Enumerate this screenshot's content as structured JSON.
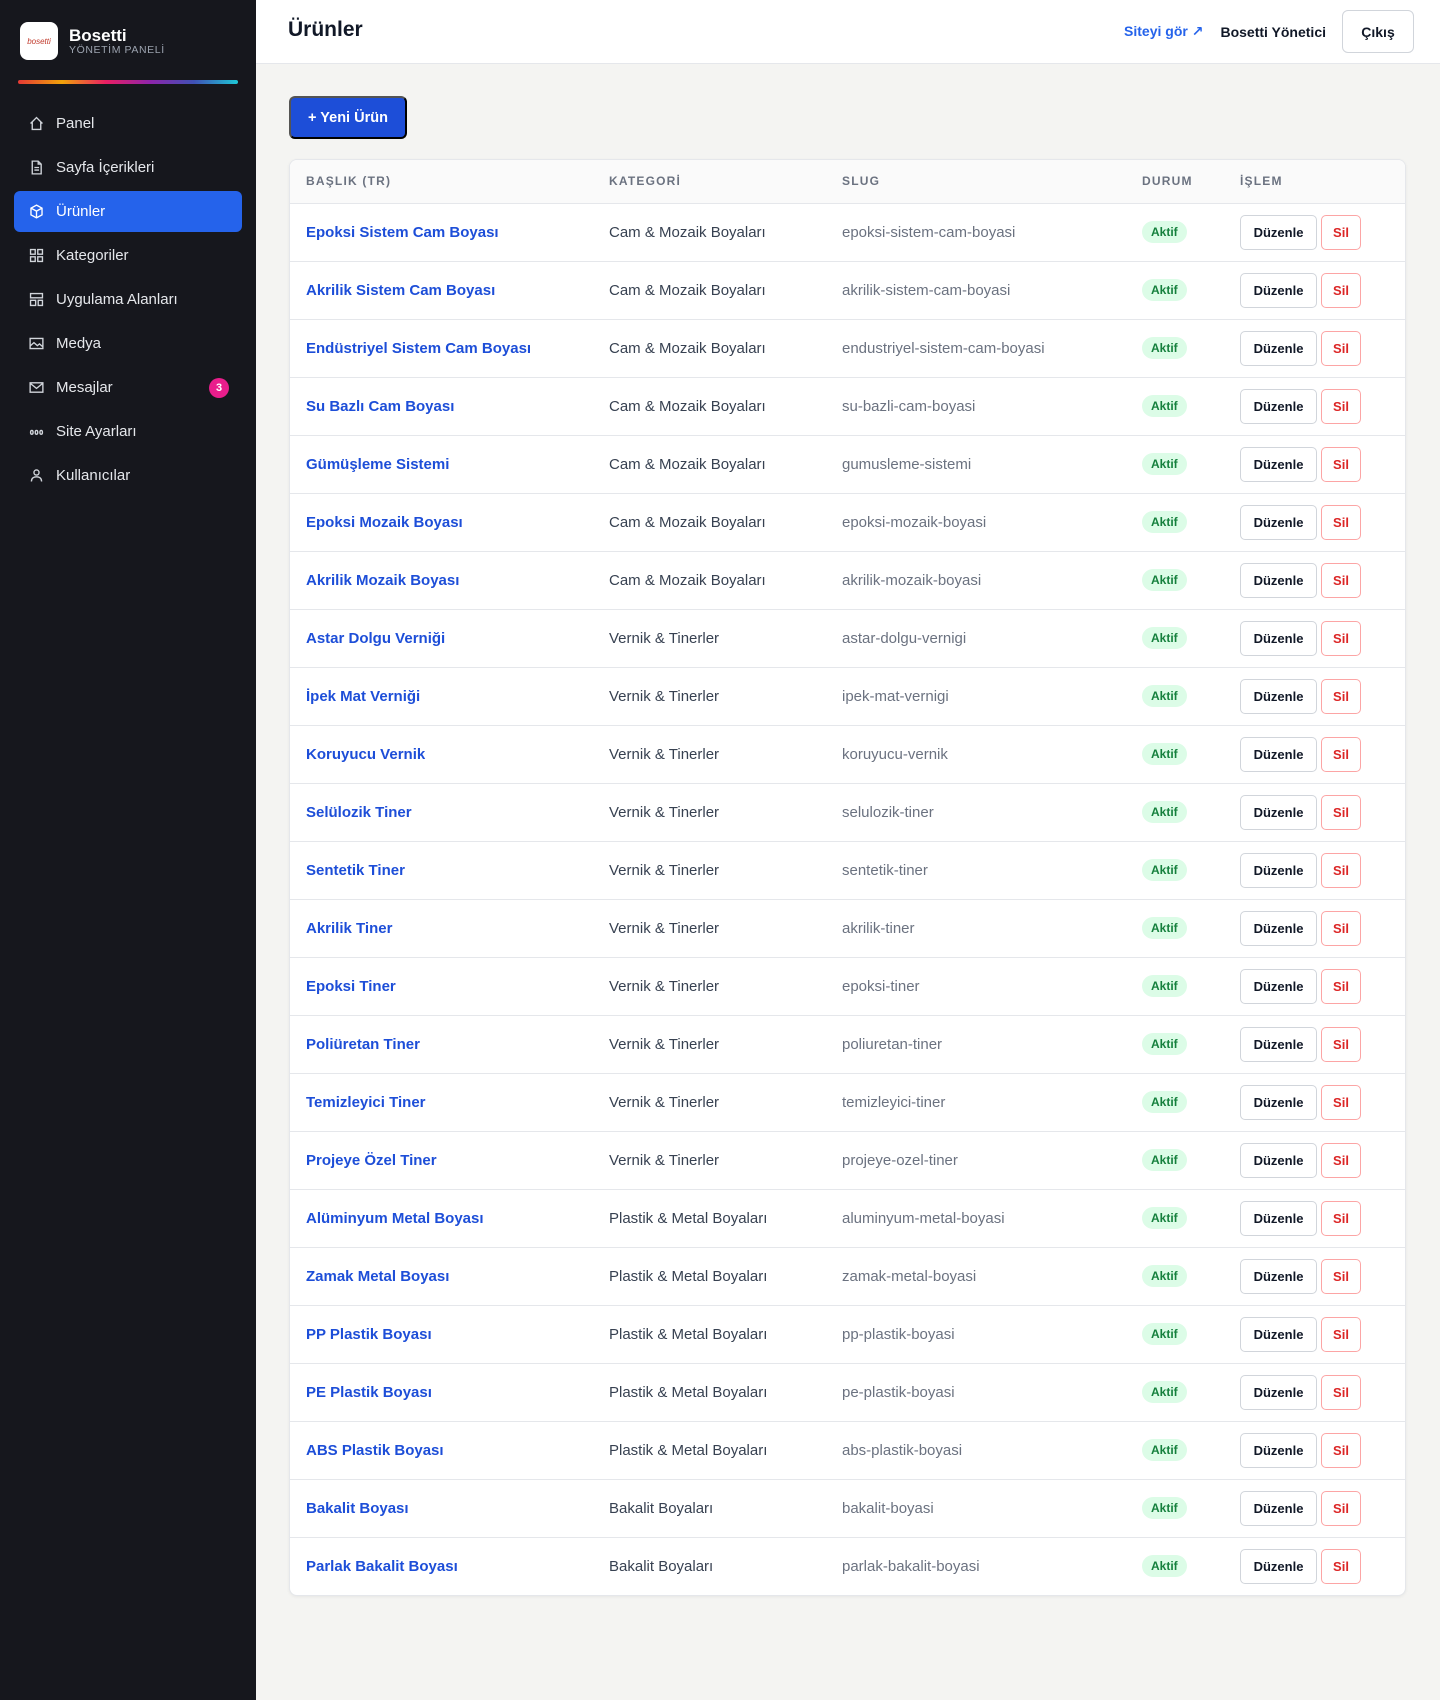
{
  "brand": {
    "logo_text": "bosetti",
    "name": "Bosetti",
    "subtitle": "YÖNETİM PANELİ"
  },
  "nav": [
    {
      "label": "Panel",
      "icon": "home-icon",
      "active": false
    },
    {
      "label": "Sayfa İçerikleri",
      "icon": "document-icon",
      "active": false
    },
    {
      "label": "Ürünler",
      "icon": "box-icon",
      "active": true
    },
    {
      "label": "Kategoriler",
      "icon": "grid-icon",
      "active": false
    },
    {
      "label": "Uygulama Alanları",
      "icon": "layout-icon",
      "active": false
    },
    {
      "label": "Medya",
      "icon": "image-icon",
      "active": false
    },
    {
      "label": "Mesajlar",
      "icon": "mail-icon",
      "active": false,
      "badge": "3"
    },
    {
      "label": "Site Ayarları",
      "icon": "settings-icon",
      "active": false
    },
    {
      "label": "Kullanıcılar",
      "icon": "user-icon",
      "active": false
    }
  ],
  "header": {
    "title": "Ürünler",
    "site_link": "Siteyi gör ↗",
    "admin_name": "Bosetti Yönetici",
    "logout": "Çıkış"
  },
  "new_button": "+ Yeni Ürün",
  "table": {
    "columns": [
      "BAŞLIK (TR)",
      "KATEGORİ",
      "SLUG",
      "DURUM",
      "İŞLEM"
    ],
    "edit_label": "Düzenle",
    "delete_label": "Sil",
    "rows": [
      {
        "title": "Epoksi Sistem Cam Boyası",
        "category": "Cam & Mozaik Boyaları",
        "slug": "epoksi-sistem-cam-boyasi",
        "status": "Aktif"
      },
      {
        "title": "Akrilik Sistem Cam Boyası",
        "category": "Cam & Mozaik Boyaları",
        "slug": "akrilik-sistem-cam-boyasi",
        "status": "Aktif"
      },
      {
        "title": "Endüstriyel Sistem Cam Boyası",
        "category": "Cam & Mozaik Boyaları",
        "slug": "endustriyel-sistem-cam-boyasi",
        "status": "Aktif"
      },
      {
        "title": "Su Bazlı Cam Boyası",
        "category": "Cam & Mozaik Boyaları",
        "slug": "su-bazli-cam-boyasi",
        "status": "Aktif"
      },
      {
        "title": "Gümüşleme Sistemi",
        "category": "Cam & Mozaik Boyaları",
        "slug": "gumusleme-sistemi",
        "status": "Aktif"
      },
      {
        "title": "Epoksi Mozaik Boyası",
        "category": "Cam & Mozaik Boyaları",
        "slug": "epoksi-mozaik-boyasi",
        "status": "Aktif"
      },
      {
        "title": "Akrilik Mozaik Boyası",
        "category": "Cam & Mozaik Boyaları",
        "slug": "akrilik-mozaik-boyasi",
        "status": "Aktif"
      },
      {
        "title": "Astar Dolgu Verniği",
        "category": "Vernik & Tinerler",
        "slug": "astar-dolgu-vernigi",
        "status": "Aktif"
      },
      {
        "title": "İpek Mat Verniği",
        "category": "Vernik & Tinerler",
        "slug": "ipek-mat-vernigi",
        "status": "Aktif"
      },
      {
        "title": "Koruyucu Vernik",
        "category": "Vernik & Tinerler",
        "slug": "koruyucu-vernik",
        "status": "Aktif"
      },
      {
        "title": "Selülozik Tiner",
        "category": "Vernik & Tinerler",
        "slug": "selulozik-tiner",
        "status": "Aktif"
      },
      {
        "title": "Sentetik Tiner",
        "category": "Vernik & Tinerler",
        "slug": "sentetik-tiner",
        "status": "Aktif"
      },
      {
        "title": "Akrilik Tiner",
        "category": "Vernik & Tinerler",
        "slug": "akrilik-tiner",
        "status": "Aktif"
      },
      {
        "title": "Epoksi Tiner",
        "category": "Vernik & Tinerler",
        "slug": "epoksi-tiner",
        "status": "Aktif"
      },
      {
        "title": "Poliüretan Tiner",
        "category": "Vernik & Tinerler",
        "slug": "poliuretan-tiner",
        "status": "Aktif"
      },
      {
        "title": "Temizleyici Tiner",
        "category": "Vernik & Tinerler",
        "slug": "temizleyici-tiner",
        "status": "Aktif"
      },
      {
        "title": "Projeye Özel Tiner",
        "category": "Vernik & Tinerler",
        "slug": "projeye-ozel-tiner",
        "status": "Aktif"
      },
      {
        "title": "Alüminyum Metal Boyası",
        "category": "Plastik & Metal Boyaları",
        "slug": "aluminyum-metal-boyasi",
        "status": "Aktif"
      },
      {
        "title": "Zamak Metal Boyası",
        "category": "Plastik & Metal Boyaları",
        "slug": "zamak-metal-boyasi",
        "status": "Aktif"
      },
      {
        "title": "PP Plastik Boyası",
        "category": "Plastik & Metal Boyaları",
        "slug": "pp-plastik-boyasi",
        "status": "Aktif"
      },
      {
        "title": "PE Plastik Boyası",
        "category": "Plastik & Metal Boyaları",
        "slug": "pe-plastik-boyasi",
        "status": "Aktif"
      },
      {
        "title": "ABS Plastik Boyası",
        "category": "Plastik & Metal Boyaları",
        "slug": "abs-plastik-boyasi",
        "status": "Aktif"
      },
      {
        "title": "Bakalit Boyası",
        "category": "Bakalit Boyaları",
        "slug": "bakalit-boyasi",
        "status": "Aktif"
      },
      {
        "title": "Parlak Bakalit Boyası",
        "category": "Bakalit Boyaları",
        "slug": "parlak-bakalit-boyasi",
        "status": "Aktif"
      }
    ]
  },
  "colors": {
    "sidebar_bg": "#16171d",
    "accent": "#2563eb",
    "status_active": "#15803d",
    "danger": "#dc2626",
    "badge_pink": "#e91e8c"
  }
}
